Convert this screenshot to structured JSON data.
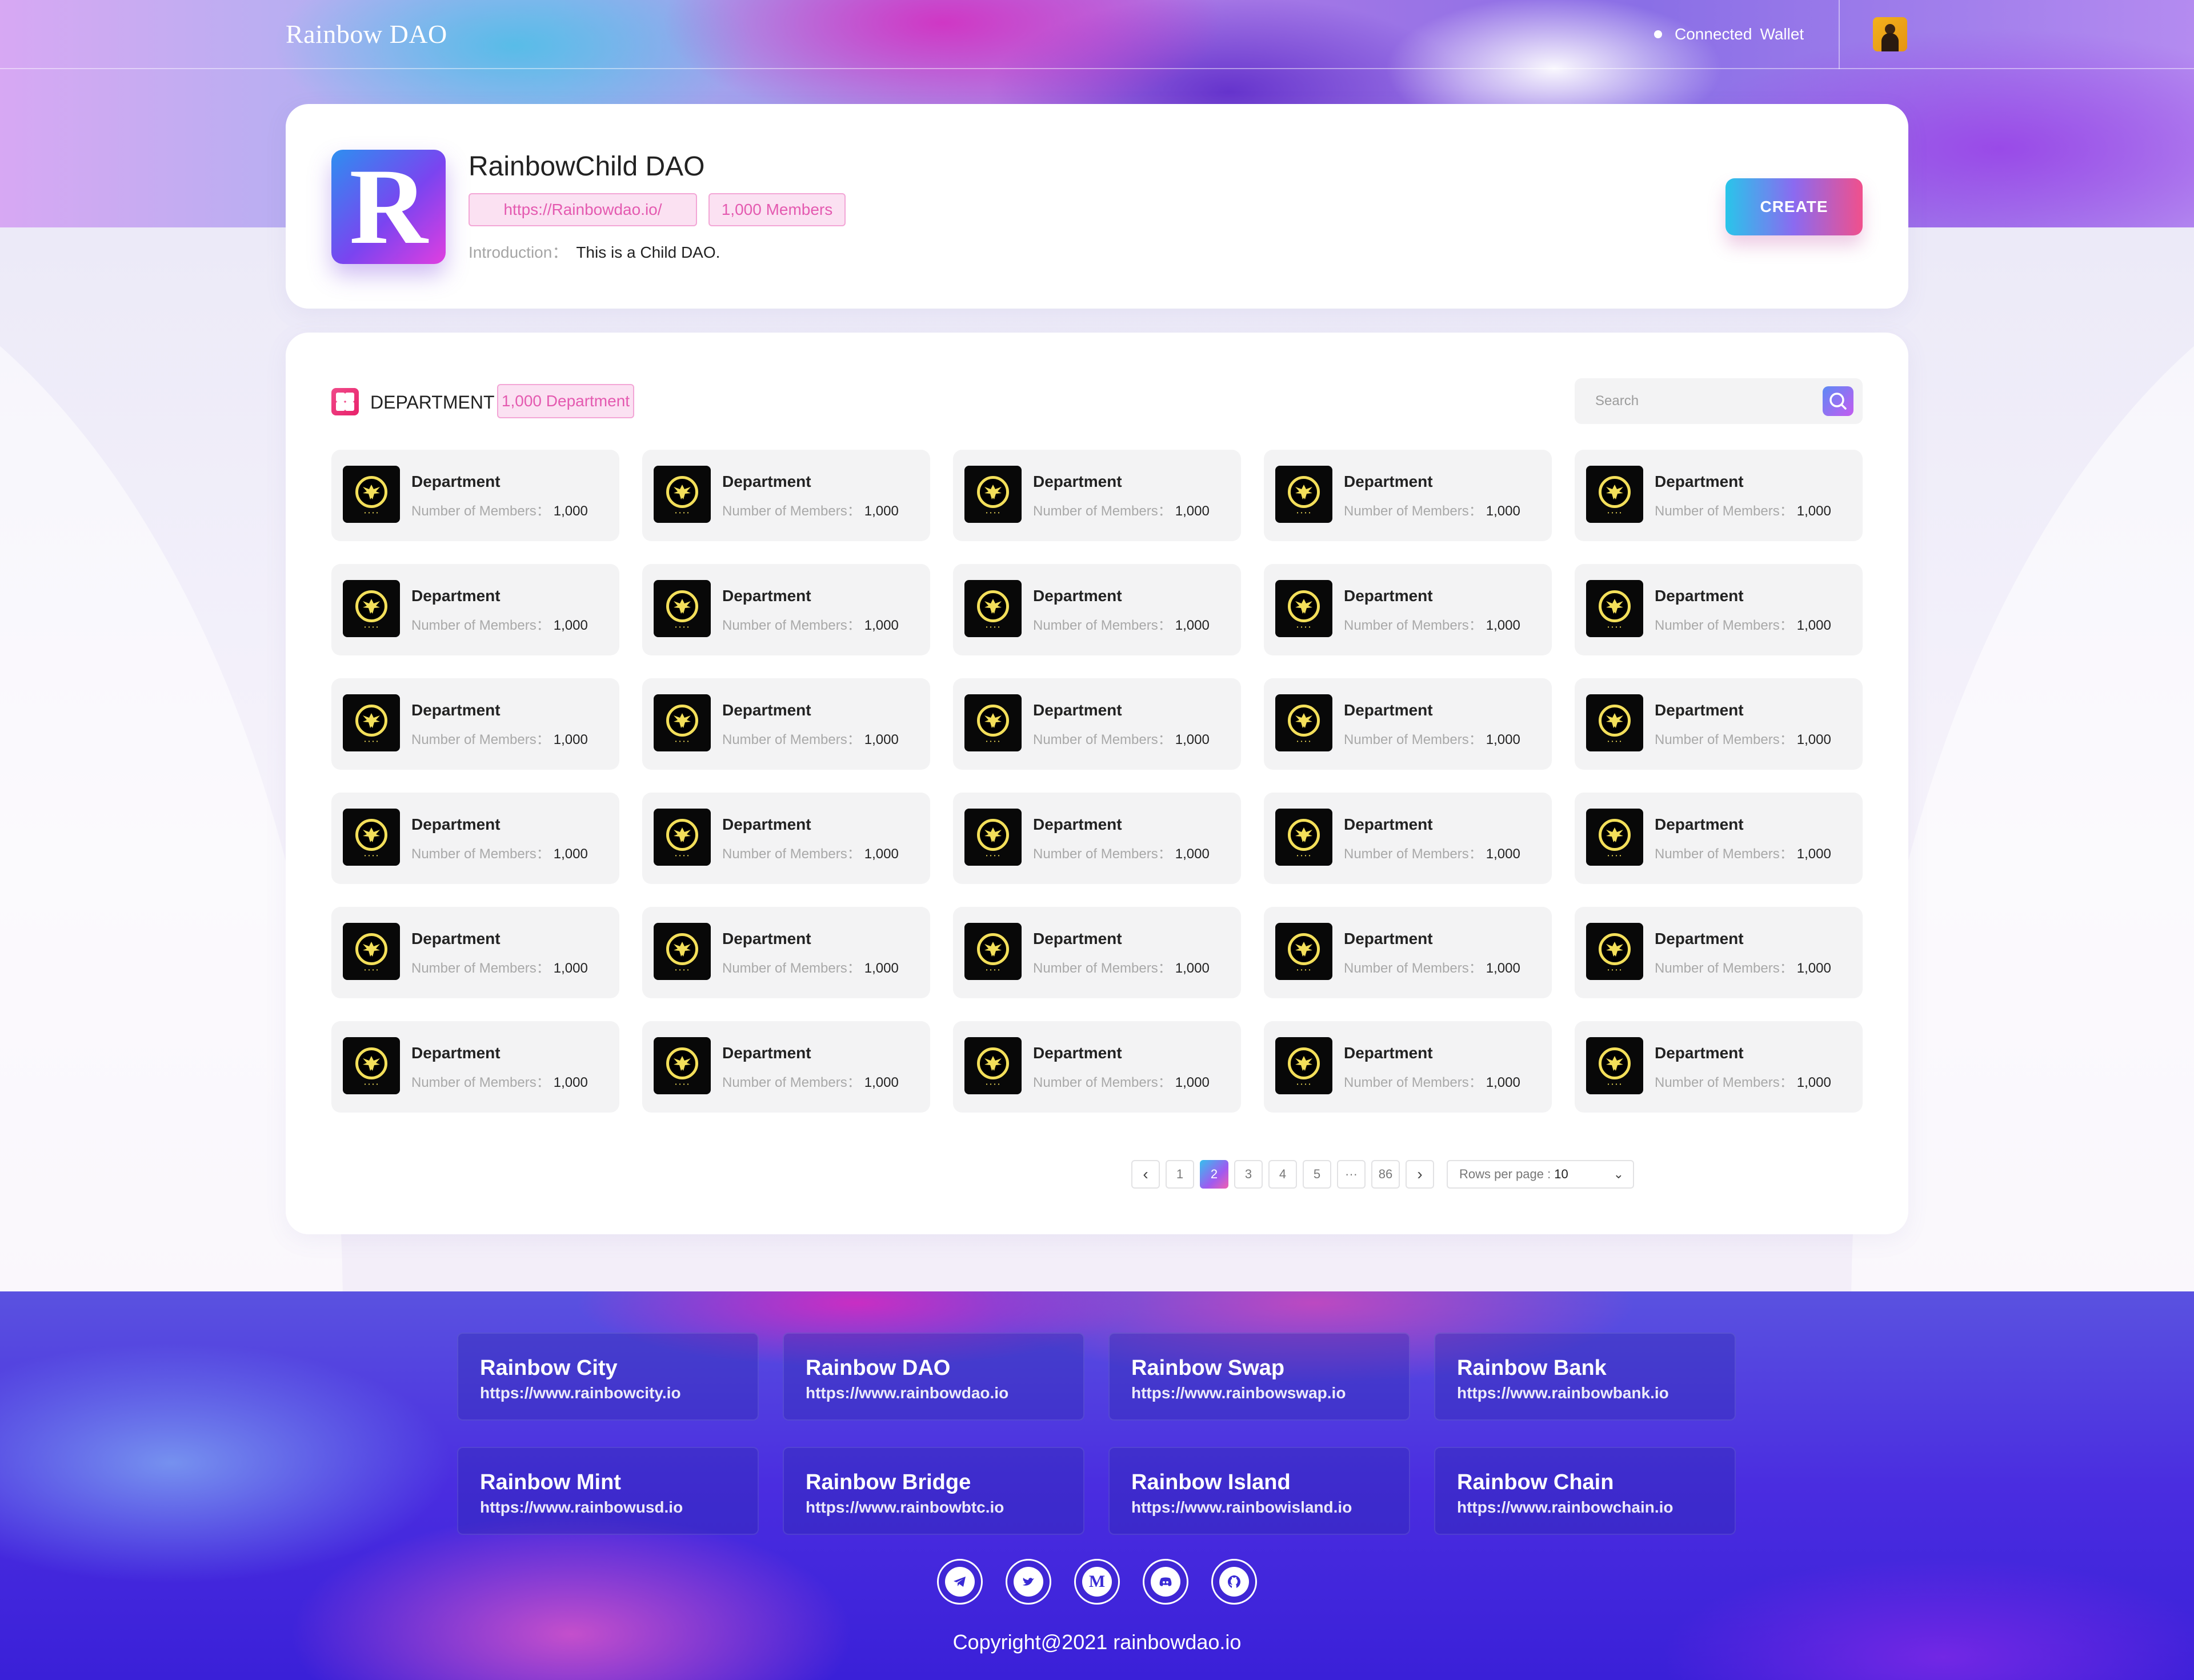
{
  "header": {
    "logo": "Rainbow DAO",
    "wallet_status": "Connected",
    "wallet_label": "Wallet"
  },
  "dao": {
    "logo_letter": "R",
    "name": "RainbowChild DAO",
    "url": "https://Rainbowdao.io/",
    "members": "1,000 Members",
    "intro_label": "Introduction：",
    "intro_text": "This is a Child DAO.",
    "create_label": "CREATE"
  },
  "departments": {
    "heading": "DEPARTMENT",
    "count": "1,000 Department",
    "search_placeholder": "Search",
    "members_label": "Number of Members：",
    "items": [
      {
        "name": "Department",
        "members": "1,000"
      },
      {
        "name": "Department",
        "members": "1,000"
      },
      {
        "name": "Department",
        "members": "1,000"
      },
      {
        "name": "Department",
        "members": "1,000"
      },
      {
        "name": "Department",
        "members": "1,000"
      },
      {
        "name": "Department",
        "members": "1,000"
      },
      {
        "name": "Department",
        "members": "1,000"
      },
      {
        "name": "Department",
        "members": "1,000"
      },
      {
        "name": "Department",
        "members": "1,000"
      },
      {
        "name": "Department",
        "members": "1,000"
      },
      {
        "name": "Department",
        "members": "1,000"
      },
      {
        "name": "Department",
        "members": "1,000"
      },
      {
        "name": "Department",
        "members": "1,000"
      },
      {
        "name": "Department",
        "members": "1,000"
      },
      {
        "name": "Department",
        "members": "1,000"
      },
      {
        "name": "Department",
        "members": "1,000"
      },
      {
        "name": "Department",
        "members": "1,000"
      },
      {
        "name": "Department",
        "members": "1,000"
      },
      {
        "name": "Department",
        "members": "1,000"
      },
      {
        "name": "Department",
        "members": "1,000"
      },
      {
        "name": "Department",
        "members": "1,000"
      },
      {
        "name": "Department",
        "members": "1,000"
      },
      {
        "name": "Department",
        "members": "1,000"
      },
      {
        "name": "Department",
        "members": "1,000"
      },
      {
        "name": "Department",
        "members": "1,000"
      },
      {
        "name": "Department",
        "members": "1,000"
      },
      {
        "name": "Department",
        "members": "1,000"
      },
      {
        "name": "Department",
        "members": "1,000"
      },
      {
        "name": "Department",
        "members": "1,000"
      },
      {
        "name": "Department",
        "members": "1,000"
      }
    ]
  },
  "pagination": {
    "pages": [
      "1",
      "2",
      "3",
      "4",
      "5",
      "···",
      "86"
    ],
    "current": "2",
    "prev_icon": "‹",
    "next_icon": "›",
    "rows_label": "Rows per page :",
    "rows_value": "10",
    "rows_chevron": "⌄"
  },
  "footer": {
    "links": [
      {
        "title": "Rainbow City",
        "url": "https://www.rainbowcity.io"
      },
      {
        "title": "Rainbow DAO",
        "url": "https://www.rainbowdao.io"
      },
      {
        "title": "Rainbow Swap",
        "url": "https://www.rainbowswap.io"
      },
      {
        "title": "Rainbow Bank",
        "url": "https://www.rainbowbank.io"
      },
      {
        "title": "Rainbow Mint",
        "url": "https://www.rainbowusd.io"
      },
      {
        "title": "Rainbow Bridge",
        "url": "https://www.rainbowbtc.io"
      },
      {
        "title": "Rainbow Island",
        "url": "https://www.rainbowisland.io"
      },
      {
        "title": "Rainbow Chain",
        "url": "https://www.rainbowchain.io"
      }
    ],
    "social": [
      "telegram-icon",
      "twitter-icon",
      "medium-icon",
      "discord-icon",
      "github-icon"
    ],
    "medium_letter": "M",
    "copyright": "Copyright@2021 rainbowdao.io"
  },
  "colors": {
    "accent_pink": "#e45ab0",
    "create_gradient": [
      "#29c5ea",
      "#8b6af0",
      "#f0508c"
    ],
    "footer_blue": "#3a20d8"
  }
}
